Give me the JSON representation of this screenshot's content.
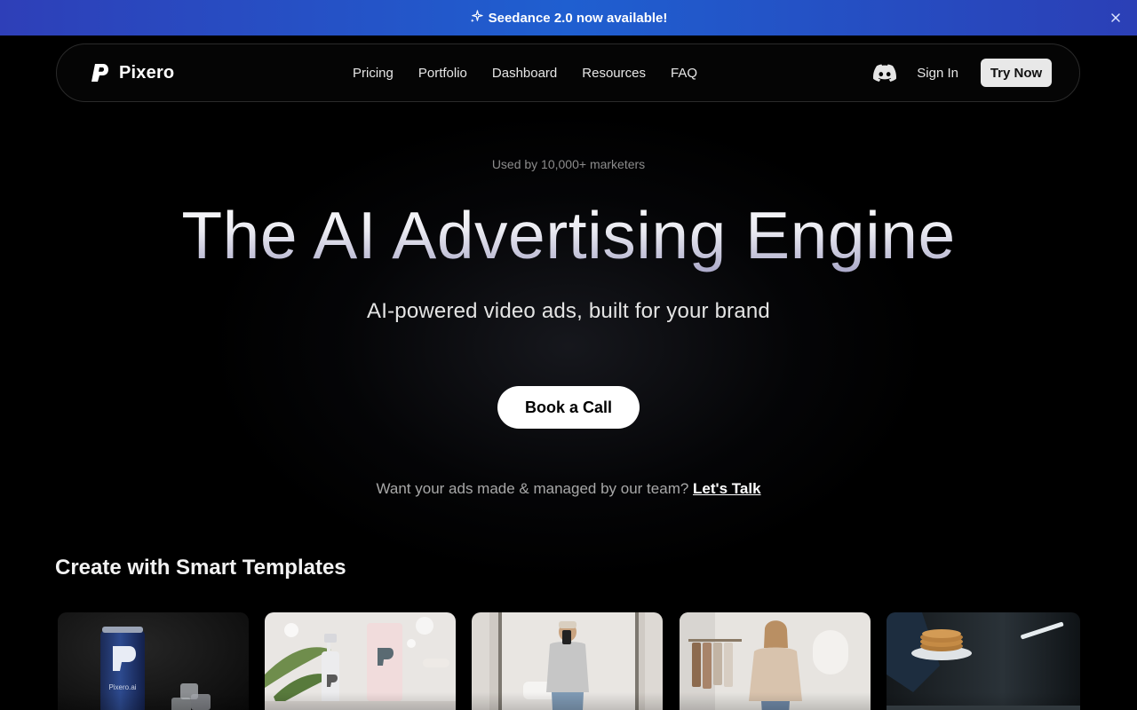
{
  "announcement": {
    "text": "Seedance 2.0 now available!",
    "icon": "sparkle-icon",
    "close_icon": "close-icon"
  },
  "nav": {
    "brand": "Pixero",
    "links": [
      "Pricing",
      "Portfolio",
      "Dashboard",
      "Resources",
      "FAQ"
    ],
    "discord_icon": "discord-icon",
    "sign_in": "Sign In",
    "try_now": "Try Now"
  },
  "hero": {
    "eyebrow": "Used by 10,000+ marketers",
    "headline": "The AI Advertising Engine",
    "subhead": "AI-powered video ads, built for your brand",
    "cta": "Book a Call",
    "talk_prefix": "Want your ads made & managed by our team?",
    "talk_link": "Let's Talk"
  },
  "templates": {
    "title": "Create with Smart Templates",
    "cards": [
      {
        "subject": "blue soda can with ice",
        "can_label": "Pixero.ai"
      },
      {
        "subject": "skincare dropper bottle and box"
      },
      {
        "subject": "person taking mirror selfie"
      },
      {
        "subject": "person in beige sweater by clothing rack"
      },
      {
        "subject": "hand holding plate of pancakes"
      }
    ]
  },
  "colors": {
    "announcement_bg": "#2448c4",
    "background": "#000000",
    "cta_bg": "#ffffff",
    "try_now_bg": "#e8e8e8"
  }
}
